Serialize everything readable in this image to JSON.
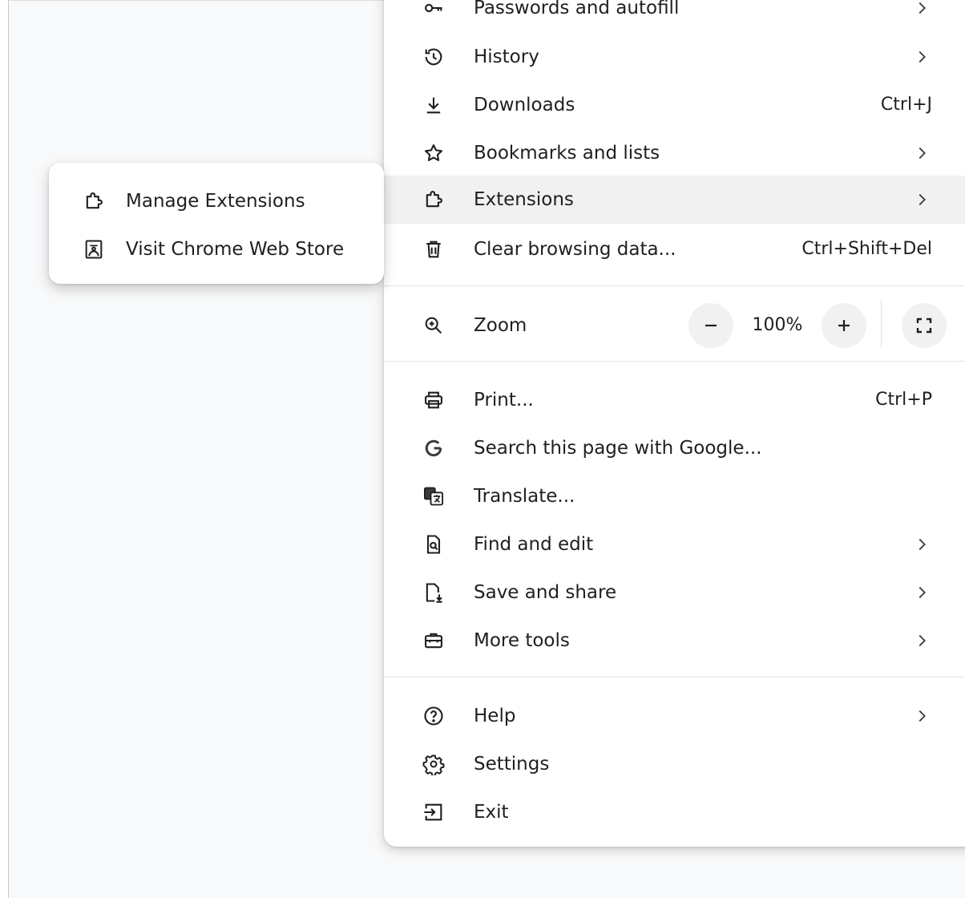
{
  "menu": {
    "items": [
      {
        "label": "Passwords and autofill",
        "icon": "key-icon",
        "has_submenu": true
      },
      {
        "label": "History",
        "icon": "history-icon",
        "has_submenu": true
      },
      {
        "label": "Downloads",
        "icon": "download-icon",
        "shortcut": "Ctrl+J"
      },
      {
        "label": "Bookmarks and lists",
        "icon": "star-icon",
        "has_submenu": true
      },
      {
        "label": "Extensions",
        "icon": "puzzle-icon",
        "has_submenu": true,
        "highlighted": true
      },
      {
        "label": "Clear browsing data...",
        "icon": "trash-icon",
        "shortcut": "Ctrl+Shift+Del"
      },
      {
        "label": "Print...",
        "icon": "printer-icon",
        "shortcut": "Ctrl+P"
      },
      {
        "label": "Search this page with Google...",
        "icon": "google-icon"
      },
      {
        "label": "Translate...",
        "icon": "translate-icon"
      },
      {
        "label": "Find and edit",
        "icon": "find-page-icon",
        "has_submenu": true
      },
      {
        "label": "Save and share",
        "icon": "save-file-icon",
        "has_submenu": true
      },
      {
        "label": "More tools",
        "icon": "toolbox-icon",
        "has_submenu": true
      },
      {
        "label": "Help",
        "icon": "help-icon",
        "has_submenu": true
      },
      {
        "label": "Settings",
        "icon": "gear-icon"
      },
      {
        "label": "Exit",
        "icon": "exit-icon"
      }
    ],
    "zoom": {
      "label": "Zoom",
      "value": "100%",
      "icon": "zoom-in-icon"
    }
  },
  "extensions_submenu": {
    "items": [
      {
        "label": "Manage Extensions",
        "icon": "puzzle-icon"
      },
      {
        "label": "Visit Chrome Web Store",
        "icon": "web-store-icon"
      }
    ]
  },
  "colors": {
    "text": "#1f1f1f",
    "highlight": "#f1f1f1",
    "page_background": "#f8f9fa",
    "menu_background": "#ffffff",
    "separator": "#e3e3e3"
  }
}
